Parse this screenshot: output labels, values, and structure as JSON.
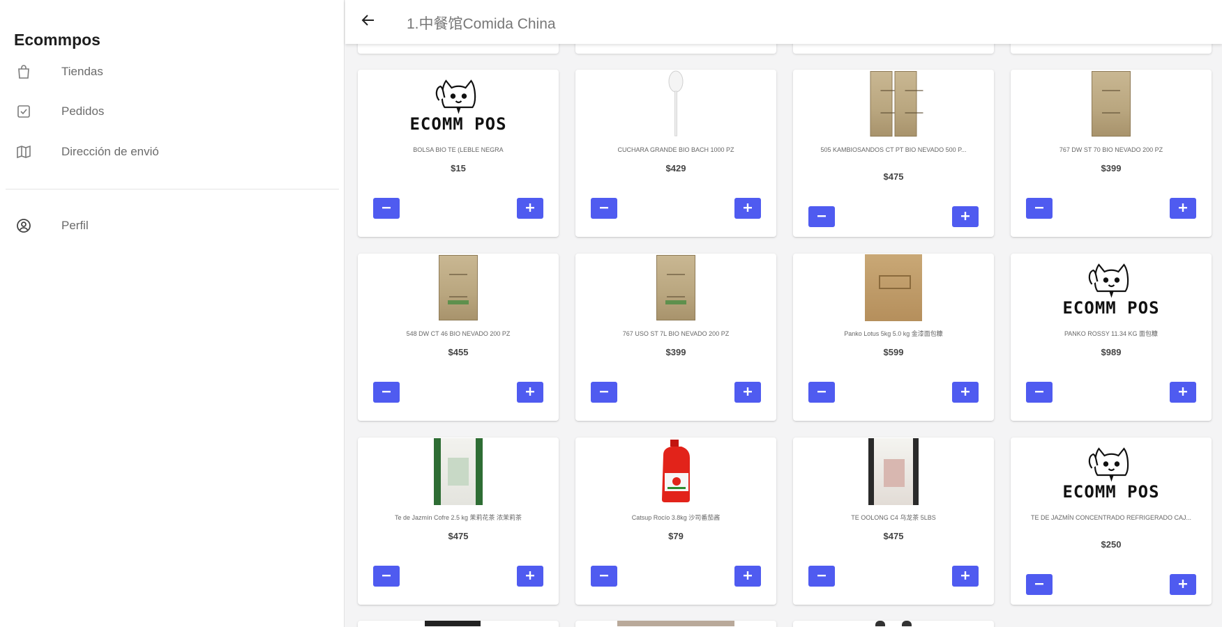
{
  "app": {
    "brand": "Ecommpos"
  },
  "sidebar": {
    "items": [
      {
        "label": "Tiendas",
        "icon": "shopping-bag-icon"
      },
      {
        "label": "Pedidos",
        "icon": "checkbox-icon"
      },
      {
        "label": "Dirección de envió",
        "icon": "map-icon"
      }
    ],
    "profile": {
      "label": "Perfil",
      "icon": "account-circle-icon"
    }
  },
  "header": {
    "title": "1.中餐馆Comida China",
    "back_icon": "arrow-left-icon"
  },
  "colors": {
    "accent": "#4f5bf0",
    "sidebar_bg": "#ffffff",
    "page_bg": "#f4f4f5"
  },
  "buttons": {
    "minus": "−",
    "plus": "+"
  },
  "logo_text": "ECOMM POS",
  "products": [
    {
      "name": "BOLSA BIO TE (LEBLE NEGRA",
      "price": "$15",
      "image": "logo"
    },
    {
      "name": "CUCHARA GRANDE BIO BACH 1000 PZ",
      "price": "$429",
      "image": "spoon"
    },
    {
      "name": "505 KAMBIOSANDOS CT PT BIO NEVADO 500 P...",
      "price": "$475",
      "image": "box-double"
    },
    {
      "name": "767 DW ST 70 BIO NEVADO 200 PZ",
      "price": "$399",
      "image": "box"
    },
    {
      "name": "548 DW CT 46 BIO NEVADO 200 PZ",
      "price": "$455",
      "image": "box-green"
    },
    {
      "name": "767 USO ST 7L BIO NEVADO 200 PZ",
      "price": "$399",
      "image": "box-green"
    },
    {
      "name": "Panko Lotus 5kg 5.0 kg 金漆面包糠",
      "price": "$599",
      "image": "carton"
    },
    {
      "name": "PANKO ROSSY 11.34 KG 面包糠",
      "price": "$989",
      "image": "logo"
    },
    {
      "name": "Te de Jazmín Cofre 2.5 kg 茉莉花茶 浓茉莉茶",
      "price": "$475",
      "image": "bag-green"
    },
    {
      "name": "Catsup Rocío 3.8kg 沙司番茄酱",
      "price": "$79",
      "image": "ketchup"
    },
    {
      "name": "TE OOLONG C4 乌龙茶 5LBS",
      "price": "$475",
      "image": "bag-red"
    },
    {
      "name": "TE DE JAZMÍN CONCENTRADO REFRIGERADO CAJ...",
      "price": "$250",
      "image": "logo"
    }
  ]
}
